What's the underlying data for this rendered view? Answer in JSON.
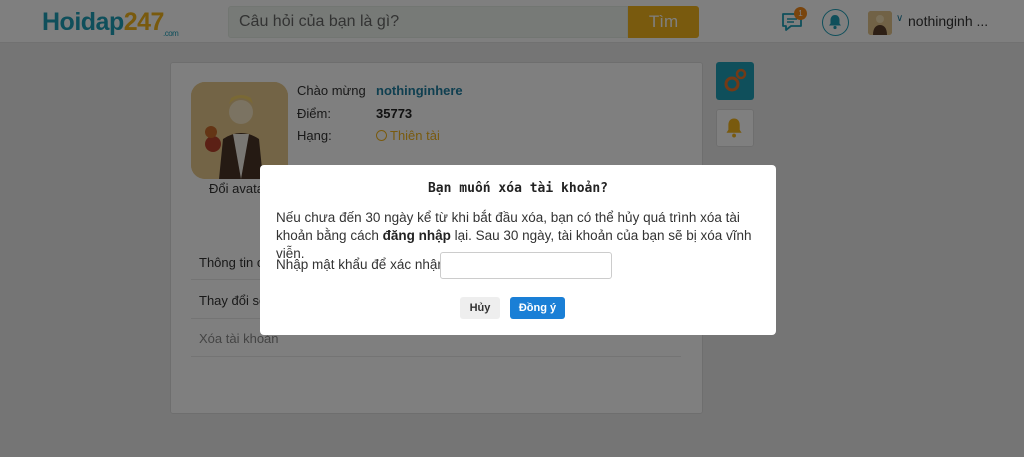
{
  "header": {
    "logo": {
      "main": "Hoidap",
      "num": "247",
      "domain": ".com"
    },
    "search": {
      "placeholder": "Câu hỏi của bạn là gì?",
      "button_label": "Tìm"
    },
    "notifications": {
      "chat_badge": "1"
    },
    "user": {
      "name": "nothinginh ..."
    }
  },
  "profile": {
    "greeting_label": "Chào mừng",
    "username": "nothinginhere",
    "points_label": "Điểm:",
    "points_value": "35773",
    "rank_label": "Hạng:",
    "rank_value": "Thiên tài",
    "change_avatar": "Đổi avata",
    "menu": [
      {
        "label": "Thông tin c"
      },
      {
        "label": "Thay đổi số"
      },
      {
        "label": "Xóa tài khoản"
      }
    ]
  },
  "modal": {
    "title": "Bạn muốn xóa tài khoản?",
    "text_part1": "Nếu chưa đến 30 ngày kể từ khi bắt đầu xóa, bạn có thể hủy quá trình xóa tài khoản bằng cách ",
    "text_bold": "đăng nhập",
    "text_part2": " lại. Sau 30 ngày, tài khoản của bạn sẽ bị xóa vĩnh viễn.",
    "password_label": "Nhập mật khẩu để xác nhận:",
    "password_value": "",
    "cancel_label": "Hủy",
    "confirm_label": "Đồng ý"
  },
  "colors": {
    "brand_teal": "#1f9fb7",
    "brand_yellow": "#f2b41c",
    "confirm_blue": "#1a7fd6"
  }
}
